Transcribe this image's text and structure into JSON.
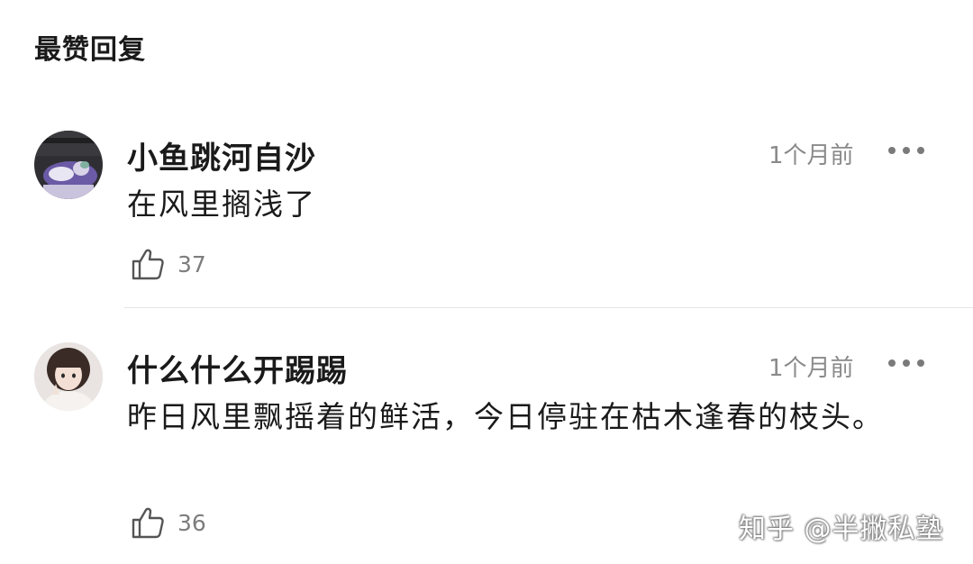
{
  "section": {
    "title": "最赞回复"
  },
  "comments": [
    {
      "author": "小鱼跳河自沙",
      "time": "1个月前",
      "content": "在风里搁浅了",
      "likes": "37"
    },
    {
      "author": "什么什么开踢踢",
      "time": "1个月前",
      "content": "昨日风里飘摇着的鲜活，今日停驻在枯木逢春的枝头。",
      "likes": "36"
    }
  ],
  "watermark": {
    "text": "知乎 @半撇私塾"
  },
  "icons": {
    "like": "thumbs-up-icon",
    "more": "more-dots-icon"
  },
  "colors": {
    "text_primary": "#1a1a1a",
    "text_secondary": "#8a8a8a",
    "divider": "#e6e6e6"
  }
}
